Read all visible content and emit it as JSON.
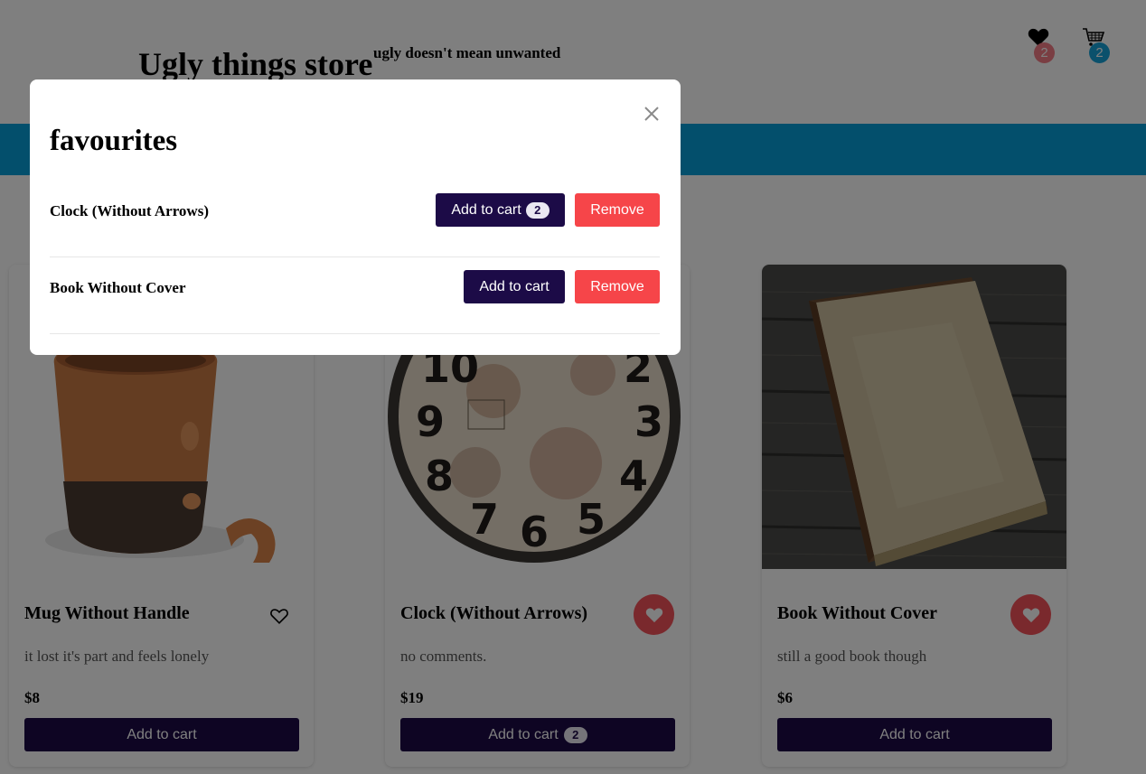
{
  "header": {
    "title": "Ugly things store",
    "tagline": "ugly doesn't mean unwanted",
    "favourites_count": "2",
    "cart_count": "2"
  },
  "colors": {
    "primary": "#1c0b47",
    "banner": "#079ed8",
    "remove": "#f64549",
    "heart_active": "#f4525a",
    "cart_badge": "#17a2d8",
    "fav_badge": "#f47c86"
  },
  "products": [
    {
      "name": "Mug Without Handle",
      "description": "it lost it's part and feels lonely",
      "price": "$8",
      "button_label": "Add to cart",
      "cart_qty": "",
      "favourited": false,
      "image_icon": "mug-image"
    },
    {
      "name": "Clock (Without Arrows)",
      "description": "no comments.",
      "price": "$19",
      "button_label": "Add to cart",
      "cart_qty": "2",
      "favourited": true,
      "image_icon": "clock-image"
    },
    {
      "name": "Book Without Cover",
      "description": "still a good book though",
      "price": "$6",
      "button_label": "Add to cart",
      "cart_qty": "",
      "favourited": true,
      "image_icon": "book-image"
    }
  ],
  "modal": {
    "title": "favourites",
    "close_icon": "close-icon",
    "items": [
      {
        "name": "Clock (Without Arrows)",
        "add_label": "Add to cart",
        "cart_qty": "2",
        "remove_label": "Remove"
      },
      {
        "name": "Book Without Cover",
        "add_label": "Add to cart",
        "cart_qty": "",
        "remove_label": "Remove"
      }
    ]
  }
}
